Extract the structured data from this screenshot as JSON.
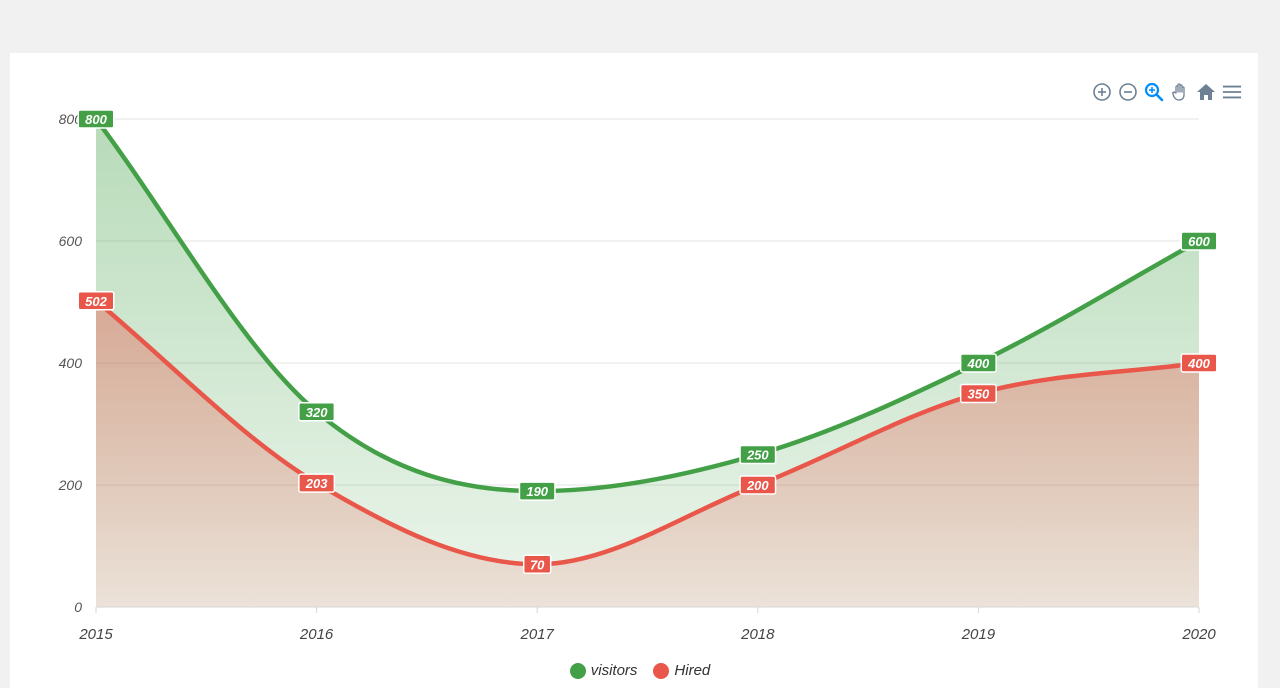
{
  "chart_data": {
    "type": "area",
    "categories": [
      "2015",
      "2016",
      "2017",
      "2018",
      "2019",
      "2020"
    ],
    "series": [
      {
        "name": "visitors",
        "values": [
          800,
          320,
          190,
          250,
          400,
          600
        ],
        "color": "#43a047"
      },
      {
        "name": "Hired",
        "values": [
          502,
          203,
          70,
          200,
          350,
          400
        ],
        "color": "#e8574a"
      }
    ],
    "ylim": [
      0,
      800
    ],
    "yticks": [
      0,
      200,
      400,
      600,
      800
    ],
    "grid": true,
    "curve": "smooth",
    "data_labels": true,
    "legend_position": "bottom-center"
  },
  "toolbar": {
    "icons": [
      "zoom-in-icon",
      "zoom-out-icon",
      "selection-zoom-icon",
      "pan-hand-icon",
      "home-reset-icon",
      "menu-icon"
    ],
    "icon_color": "#6e8192",
    "active_color": "#008ffb"
  }
}
